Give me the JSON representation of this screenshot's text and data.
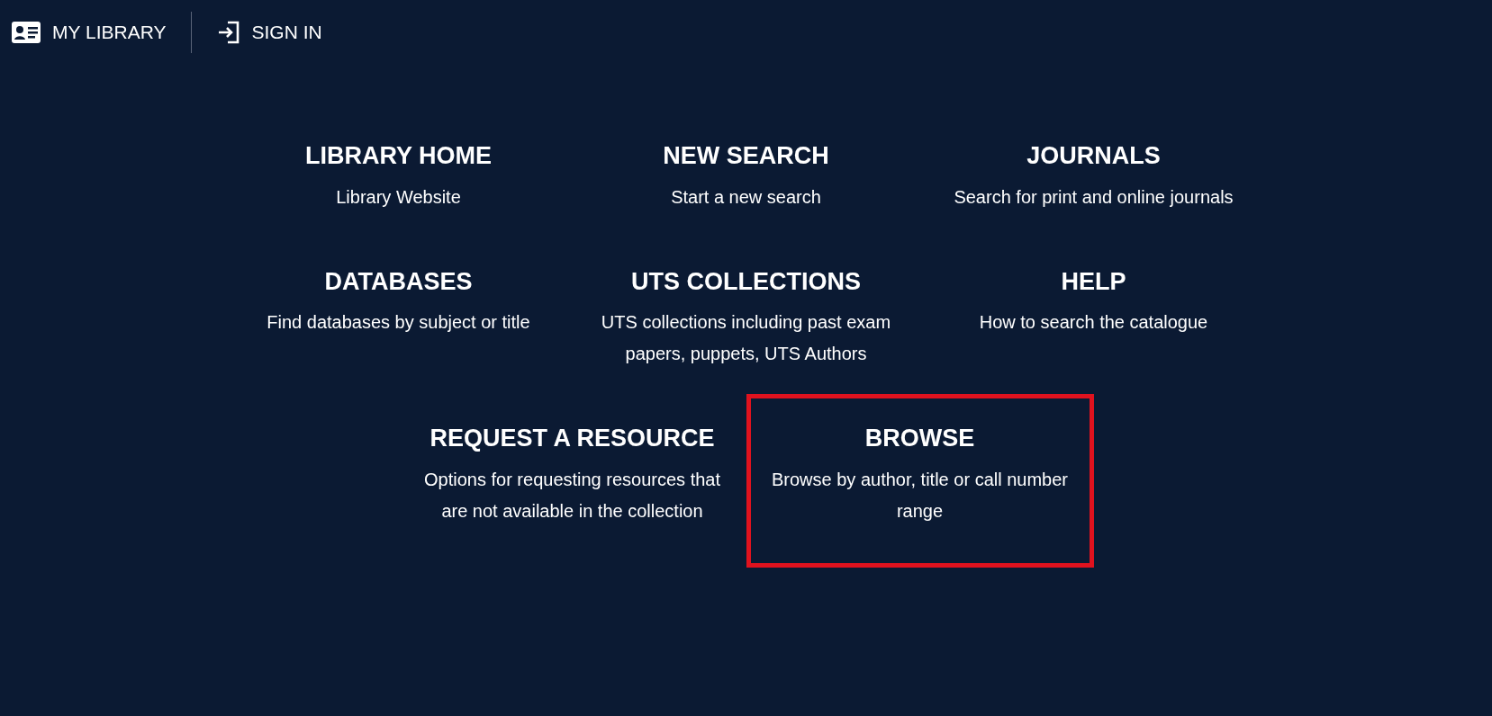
{
  "top_bar": {
    "links": [
      {
        "kind": "library",
        "label": "MY LIBRARY"
      },
      {
        "kind": "signin",
        "label": "SIGN IN"
      }
    ]
  },
  "menu": {
    "items": [
      {
        "title": "LIBRARY HOME",
        "description": "Library Website",
        "highlighted": false
      },
      {
        "title": "NEW SEARCH",
        "description": "Start a new search",
        "highlighted": false
      },
      {
        "title": "JOURNALS",
        "description": "Search for print and online journals",
        "highlighted": false
      },
      {
        "title": "DATABASES",
        "description": "Find databases by subject or title",
        "highlighted": false
      },
      {
        "title": "UTS COLLECTIONS",
        "description": "UTS collections including past exam papers, puppets, UTS Authors",
        "highlighted": false
      },
      {
        "title": "HELP",
        "description": "How to search the catalogue",
        "highlighted": false
      },
      {
        "title": "REQUEST A RESOURCE",
        "description": "Options for requesting resources that are not available in the collection",
        "highlighted": false
      },
      {
        "title": "BROWSE",
        "description": "Browse by author, title or call number range",
        "highlighted": true
      }
    ]
  }
}
